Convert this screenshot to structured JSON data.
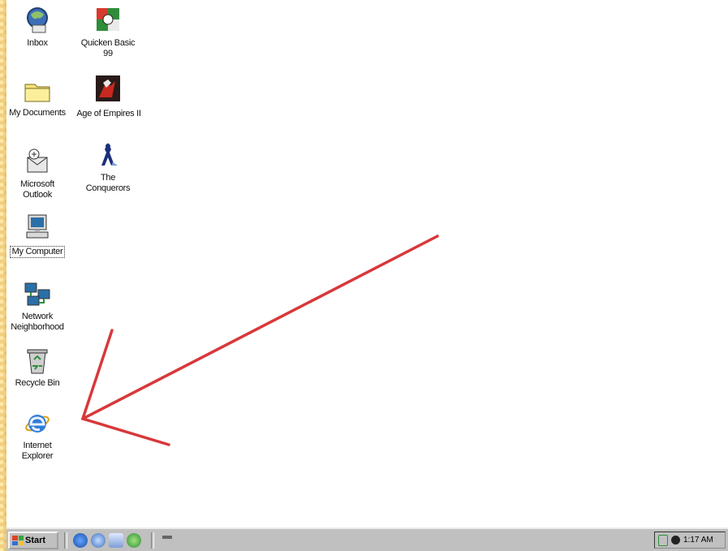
{
  "desktop": {
    "icons": [
      {
        "label": "Inbox",
        "icon": "inbox-icon"
      },
      {
        "label": "Quicken Basic 99",
        "icon": "quicken-icon"
      },
      {
        "label": "My Documents",
        "icon": "folder-icon"
      },
      {
        "label": "Age of Empires II",
        "icon": "age-of-empires-icon"
      },
      {
        "label": "Microsoft Outlook",
        "icon": "outlook-icon"
      },
      {
        "label": "The Conquerors",
        "icon": "conquerors-icon"
      },
      {
        "label": "My Computer",
        "icon": "computer-icon"
      },
      {
        "label": "Network Neighborhood",
        "icon": "network-icon"
      },
      {
        "label": "Recycle Bin",
        "icon": "recycle-bin-icon"
      },
      {
        "label": "Internet Explorer",
        "icon": "internet-explorer-icon"
      }
    ],
    "annotation": {
      "type": "red-arrow",
      "color": "#d8383a",
      "points_to": "Internet Explorer"
    }
  },
  "taskbar": {
    "start_label": "Start",
    "quick_launch": [
      "internet-explorer-icon",
      "outlook-express-icon",
      "show-desktop-icon",
      "channels-icon"
    ],
    "clock": "1:17 AM"
  },
  "colors": {
    "desktop": "#ffffff",
    "taskbar": "#c0c0c0",
    "border": "#f1cf80",
    "arrow": "#d8383a"
  }
}
